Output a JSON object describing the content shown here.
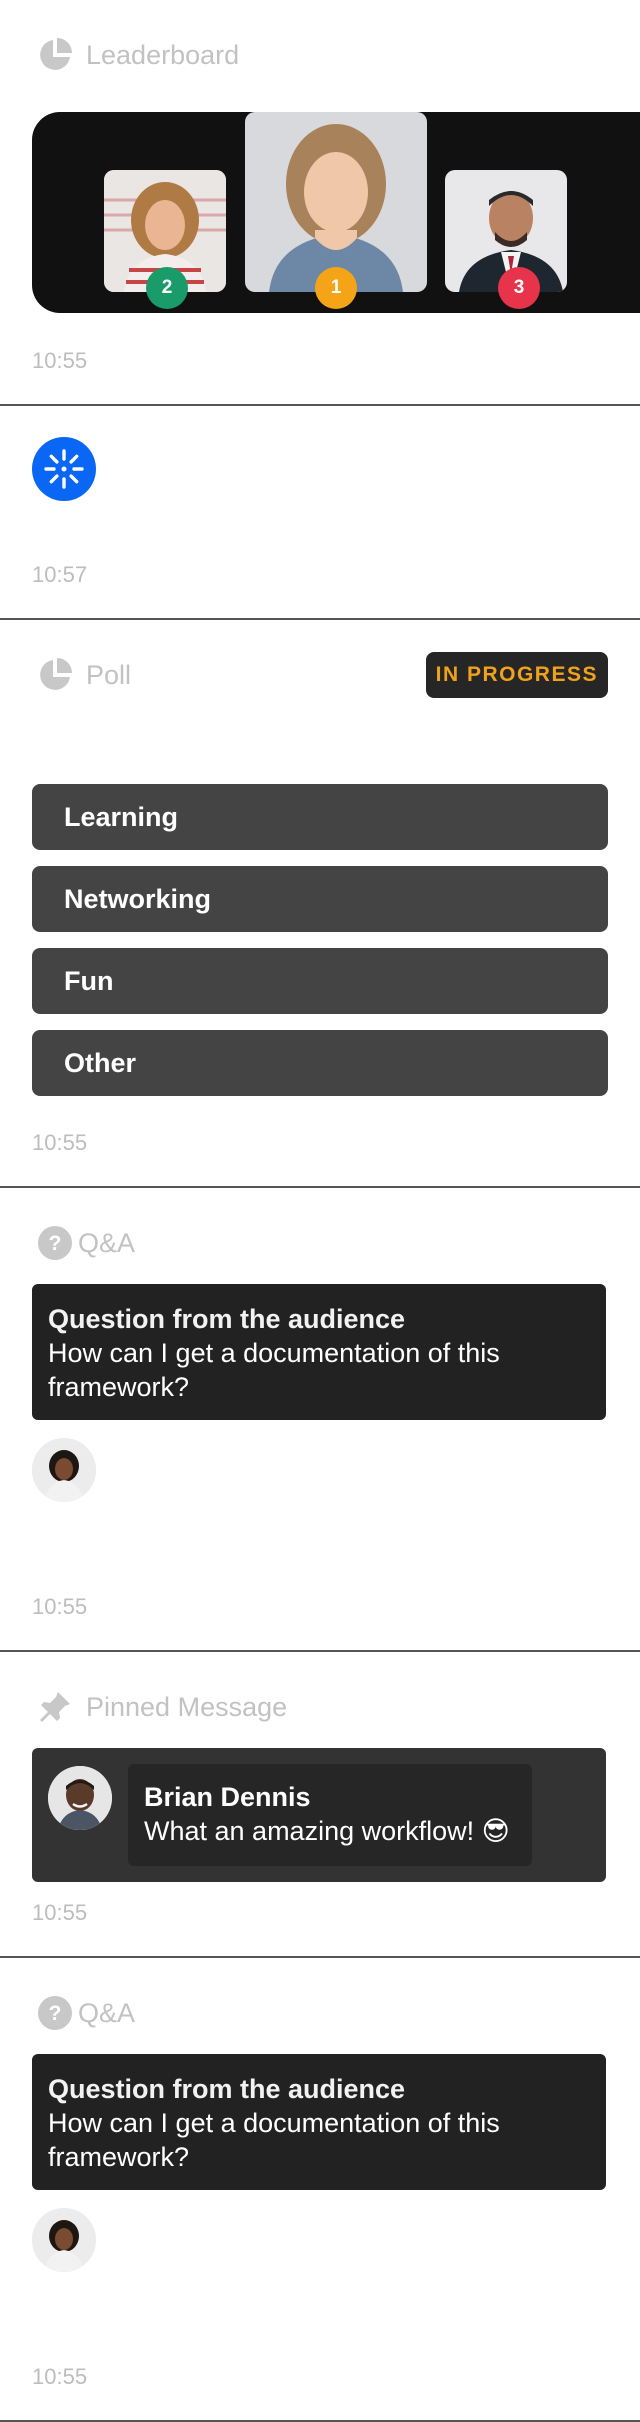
{
  "leaderboard": {
    "title": "Leaderboard",
    "ranks": [
      "2",
      "1",
      "3"
    ],
    "medal_colors": [
      "#1a9b6a",
      "#f4a416",
      "#e8344a"
    ],
    "time": "10:55"
  },
  "loading": {
    "time": "10:57",
    "accent": "#0a66f5"
  },
  "poll": {
    "title": "Poll",
    "status": "IN PROGRESS",
    "status_color": "#f0a21a",
    "options": [
      "Learning",
      "Networking",
      "Fun",
      "Other"
    ],
    "time": "10:55"
  },
  "qa1": {
    "title": "Q&A",
    "question_title": "Question from the audience",
    "question_text": "How can I get a documentation of this framework?",
    "time": "10:55"
  },
  "pinned": {
    "title": "Pinned Message",
    "author": "Brian Dennis",
    "message": "What an amazing workflow! 😎",
    "time": "10:55"
  },
  "qa2": {
    "title": "Q&A",
    "question_title": "Question from the audience",
    "question_text": "How can I get a documentation of this framework?",
    "time": "10:55"
  }
}
